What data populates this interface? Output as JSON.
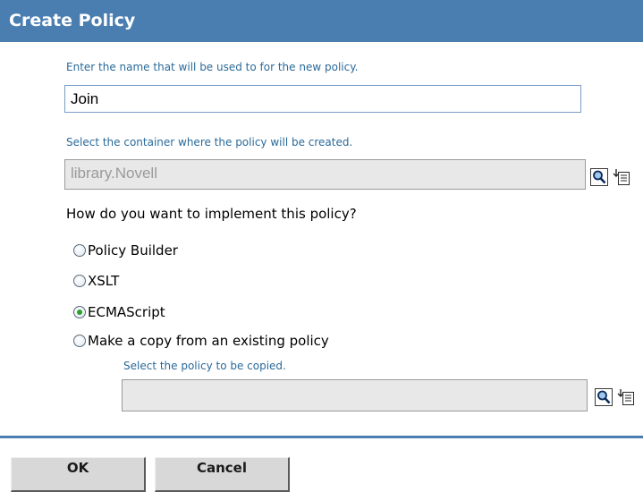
{
  "header": {
    "title": "Create Policy"
  },
  "name_field": {
    "hint": "Enter the name that will be used to for the new policy.",
    "value": "Join"
  },
  "container_field": {
    "hint": "Select the container where the policy will be created.",
    "value": "library.Novell"
  },
  "implementation": {
    "question": "How do you want to implement this policy?",
    "options": [
      {
        "label": "Policy Builder",
        "selected": false
      },
      {
        "label": "XSLT",
        "selected": false
      },
      {
        "label": "ECMAScript",
        "selected": true
      },
      {
        "label": "Make a copy from an existing policy",
        "selected": false
      }
    ]
  },
  "copy_field": {
    "hint": "Select the policy to be copied.",
    "value": ""
  },
  "icons": {
    "browse": "magnifier-icon",
    "history": "history-list-icon"
  },
  "buttons": {
    "ok": "OK",
    "cancel": "Cancel"
  },
  "colors": {
    "header_bg": "#4a7eb1",
    "hint_text": "#2a6a9a",
    "selected_radio": "#2aa02a"
  }
}
